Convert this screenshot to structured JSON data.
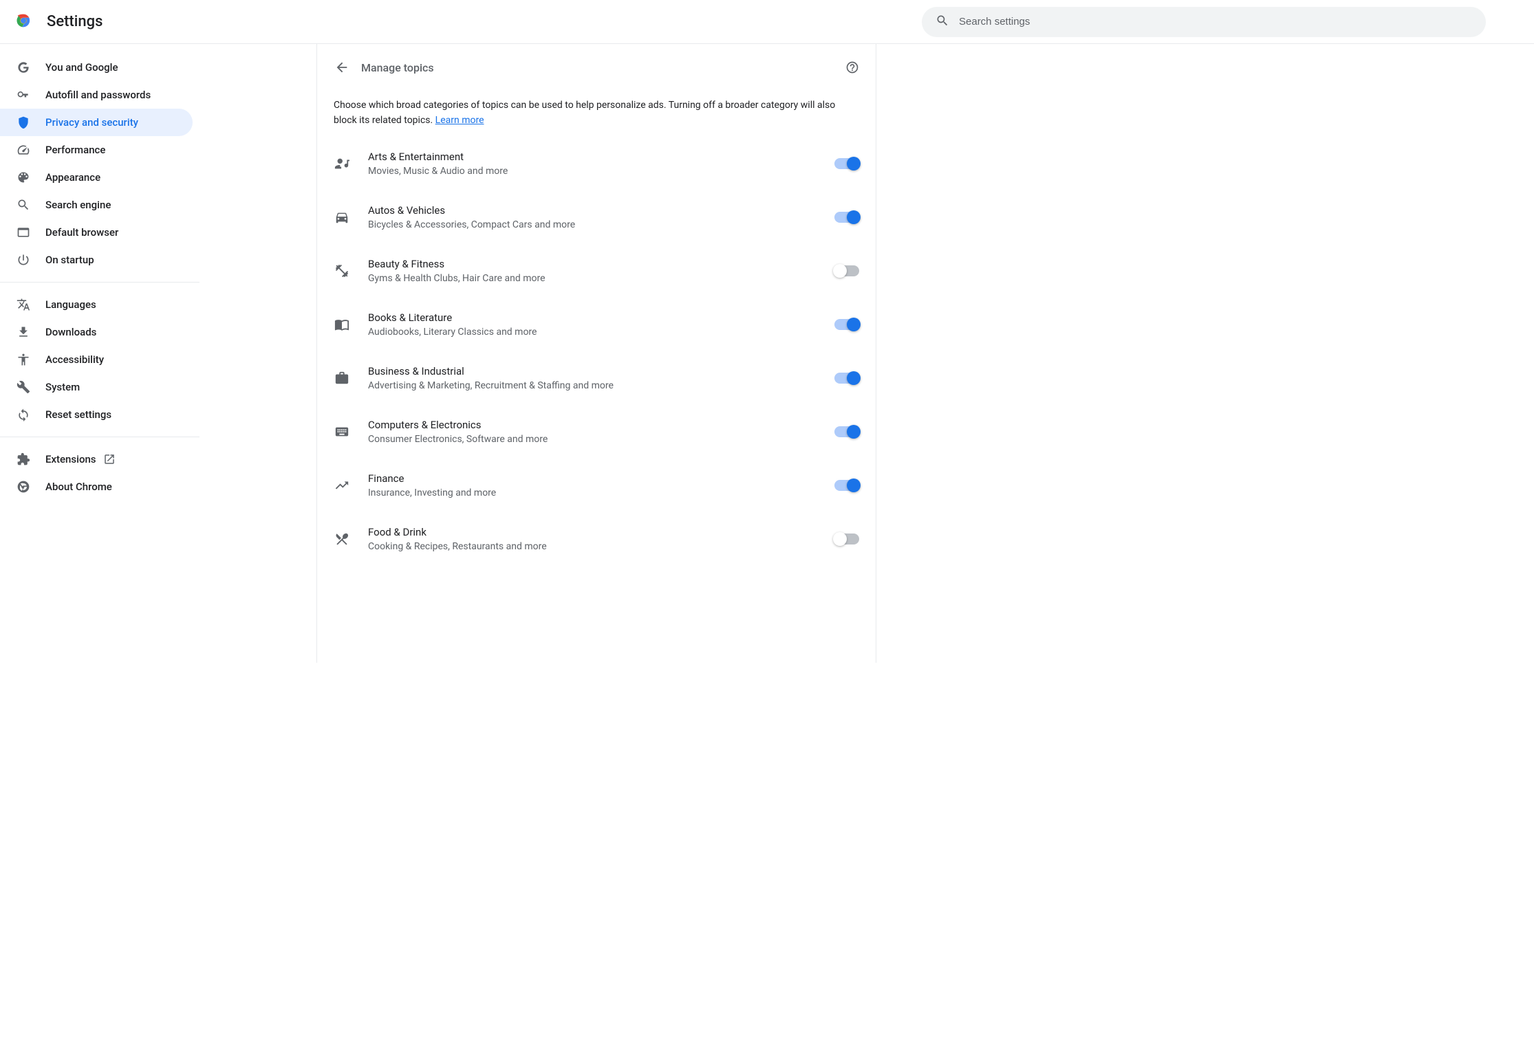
{
  "header": {
    "title": "Settings",
    "search_placeholder": "Search settings"
  },
  "sidebar": {
    "items": [
      {
        "id": "you-and-google",
        "label": "You and Google",
        "icon": "google",
        "active": false
      },
      {
        "id": "autofill",
        "label": "Autofill and passwords",
        "icon": "key",
        "active": false
      },
      {
        "id": "privacy",
        "label": "Privacy and security",
        "icon": "shield",
        "active": true
      },
      {
        "id": "performance",
        "label": "Performance",
        "icon": "speed",
        "active": false
      },
      {
        "id": "appearance",
        "label": "Appearance",
        "icon": "palette",
        "active": false
      },
      {
        "id": "search-engine",
        "label": "Search engine",
        "icon": "search",
        "active": false
      },
      {
        "id": "default-browser",
        "label": "Default browser",
        "icon": "browser",
        "active": false
      },
      {
        "id": "on-startup",
        "label": "On startup",
        "icon": "power",
        "active": false
      }
    ],
    "items2": [
      {
        "id": "languages",
        "label": "Languages",
        "icon": "translate"
      },
      {
        "id": "downloads",
        "label": "Downloads",
        "icon": "download"
      },
      {
        "id": "accessibility",
        "label": "Accessibility",
        "icon": "accessibility"
      },
      {
        "id": "system",
        "label": "System",
        "icon": "wrench"
      },
      {
        "id": "reset",
        "label": "Reset settings",
        "icon": "reset"
      }
    ],
    "items3": [
      {
        "id": "extensions",
        "label": "Extensions",
        "icon": "extension",
        "external": true
      },
      {
        "id": "about",
        "label": "About Chrome",
        "icon": "chrome"
      }
    ]
  },
  "content": {
    "page_title": "Manage topics",
    "description_text": "Choose which broad categories of topics can be used to help personalize ads. Turning off a broader category will also block its related topics. ",
    "learn_more": "Learn more",
    "topics": [
      {
        "id": "arts",
        "title": "Arts & Entertainment",
        "subtitle": "Movies, Music & Audio and more",
        "icon": "person-music",
        "enabled": true
      },
      {
        "id": "autos",
        "title": "Autos & Vehicles",
        "subtitle": "Bicycles & Accessories, Compact Cars and more",
        "icon": "car",
        "enabled": true
      },
      {
        "id": "beauty",
        "title": "Beauty & Fitness",
        "subtitle": "Gyms & Health Clubs, Hair Care and more",
        "icon": "fitness",
        "enabled": false
      },
      {
        "id": "books",
        "title": "Books & Literature",
        "subtitle": "Audiobooks, Literary Classics and more",
        "icon": "book",
        "enabled": true
      },
      {
        "id": "business",
        "title": "Business & Industrial",
        "subtitle": "Advertising & Marketing, Recruitment & Staffing and more",
        "icon": "briefcase",
        "enabled": true
      },
      {
        "id": "computers",
        "title": "Computers & Electronics",
        "subtitle": "Consumer Electronics, Software and more",
        "icon": "keyboard",
        "enabled": true
      },
      {
        "id": "finance",
        "title": "Finance",
        "subtitle": "Insurance, Investing and more",
        "icon": "chart",
        "enabled": true
      },
      {
        "id": "food",
        "title": "Food & Drink",
        "subtitle": "Cooking & Recipes, Restaurants and more",
        "icon": "food",
        "enabled": false
      }
    ]
  }
}
